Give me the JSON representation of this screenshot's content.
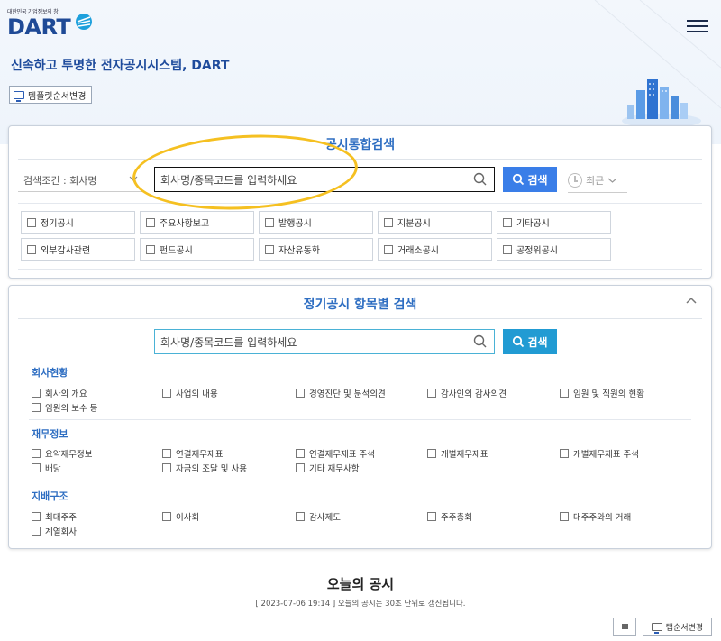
{
  "header": {
    "logo_sub": "대한민국 기업정보의 창",
    "logo_text": "DART",
    "menu_icon": "hamburger-icon"
  },
  "tagline": "신속하고 투명한 전자공시시스템, DART",
  "template_button": {
    "label": "템플릿순서변경",
    "icon": "monitor-icon"
  },
  "integrated_search": {
    "title": "공시통합검색",
    "condition_label": "검색조건 : 회사명",
    "search_value": "회사명/종목코드를 입력하세요",
    "search_button": "검색",
    "recent_label": "최근",
    "categories": [
      [
        "정기공시",
        "주요사항보고",
        "발행공시",
        "지분공시",
        "기타공시"
      ],
      [
        "외부감사관련",
        "펀드공시",
        "자산유동화",
        "거래소공시",
        "공정위공시"
      ]
    ]
  },
  "periodic_search": {
    "title": "정기공시 항목별 검색",
    "search_value": "회사명/종목코드를 입력하세요",
    "search_button": "검색",
    "sections": [
      {
        "title": "회사현황",
        "items": [
          "회사의 개요",
          "사업의 내용",
          "경영진단 및 분석의견",
          "감사인의 감사의견",
          "임원 및 직원의 현황",
          "임원의 보수 등"
        ]
      },
      {
        "title": "재무정보",
        "items": [
          "요약재무정보",
          "연결재무제표",
          "연결재무제표 주석",
          "개별재무제표",
          "개별재무제표 주석",
          "배당",
          "자금의 조달 및 사용",
          "기타 재무사항"
        ]
      },
      {
        "title": "지배구조",
        "items": [
          "최대주주",
          "이사회",
          "감사제도",
          "주주총회",
          "대주주와의 거래",
          "계열회사"
        ]
      }
    ]
  },
  "today": {
    "title": "오늘의 공시",
    "note": "[ 2023-07-06 19:14 ] 오늘의 공시는 30초 단위로 갱신됩니다.",
    "order_button": "탭순서변경"
  },
  "colors": {
    "brand_blue": "#1f4a96",
    "title_blue": "#2e6ec2",
    "search_button_1": "#3a7ee8",
    "search_button_2": "#219bd3",
    "highlight": "#f5c021"
  }
}
